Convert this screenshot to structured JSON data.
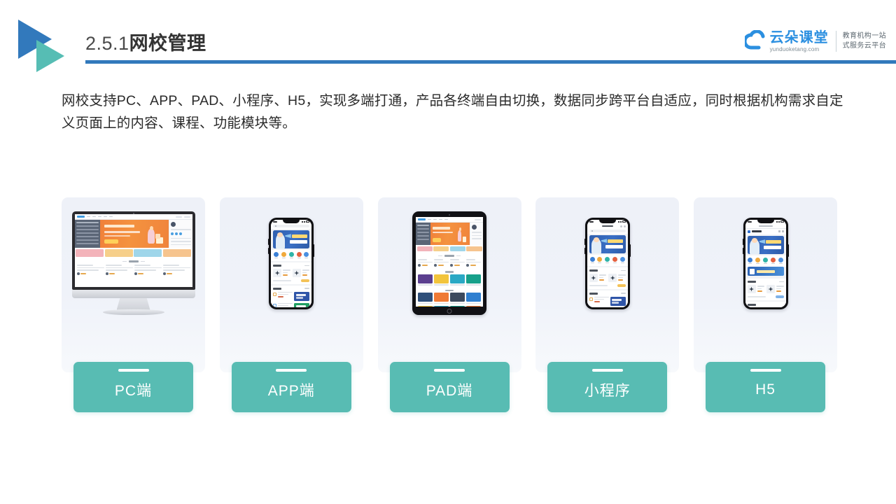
{
  "header": {
    "title_number": "2.5.1",
    "title_name": "网校管理",
    "rule_color": "#3279bc",
    "logo": {
      "triangle_blue": "#3279bc",
      "triangle_teal": "#56bdb4"
    },
    "brand": {
      "name_cn": "云朵课堂",
      "name_en": "yunduoketang.com",
      "tagline_line1": "教育机构一站",
      "tagline_line2": "式服务云平台",
      "color": "#2b8fe0"
    }
  },
  "body": {
    "paragraph": "网校支持PC、APP、PAD、小程序、H5，实现多端打通，产品各终端自由切换，数据同步跨平台自适应，同时根据机构需求自定义页面上的内容、课程、功能模块等。"
  },
  "cards": [
    {
      "id": "pc",
      "label": "PC端",
      "device": "desktop"
    },
    {
      "id": "app",
      "label": "APP端",
      "device": "phone"
    },
    {
      "id": "pad",
      "label": "PAD端",
      "device": "tablet"
    },
    {
      "id": "mini",
      "label": "小程序",
      "device": "phone"
    },
    {
      "id": "h5",
      "label": "H5",
      "device": "phone"
    }
  ],
  "theme": {
    "label_bg": "#58bcb3",
    "label_text": "#ffffff",
    "card_bg": "#eef1f8",
    "page_bg": "#ffffff",
    "hero_orange": "#f0843c",
    "hero_blue": "#2f5fae"
  },
  "screen_content": {
    "web_promo_colors": [
      "#f3b3ba",
      "#f6cf8a",
      "#9fd6ea",
      "#f6c48e"
    ],
    "grid_row1_colors": [
      "#5b3f8f",
      "#f2c43c",
      "#2aa8c4",
      "#17a08a"
    ],
    "grid_row2_colors": [
      "#2f4f7a",
      "#ef7a35",
      "#3c4a5e",
      "#2f7fd0"
    ],
    "grid_row3_colors": [
      "#f2c43c",
      "#2aa8c4",
      "#17a08a",
      "#ef7a35"
    ],
    "category_colors": [
      "#3a7fd5",
      "#f0a93c",
      "#2fb4a8",
      "#e4603f",
      "#4a8fe0"
    ],
    "lesson_thumb_colors": [
      "#2f55a8",
      "#1f9e62"
    ]
  }
}
